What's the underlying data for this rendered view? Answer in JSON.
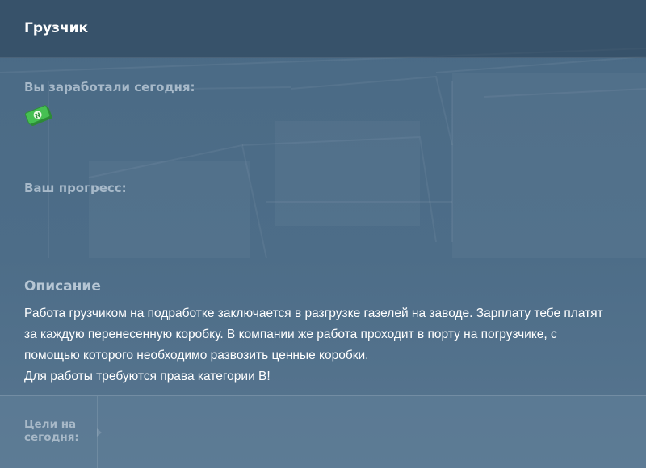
{
  "header": {
    "title": "Грузчик"
  },
  "earnings": {
    "label": "Вы заработали сегодня:",
    "icon": "money-icon"
  },
  "progress": {
    "label": "Ваш прогресс:"
  },
  "description": {
    "title": "Описание",
    "lines": [
      "Работа грузчиком на подработке заключается в разгрузке газелей на заводе. Зарплату тебе платят",
      "за каждую перенесенную коробку. В компании же работа проходит в порту на погрузчике, с",
      "помощью которого необходимо развозить ценные коробки.",
      "Для работы требуются права категории B!"
    ]
  },
  "footer": {
    "goals_label": "Цели на сегодня:"
  },
  "colors": {
    "background": "#4a6a85",
    "money_green": "#3fb34a",
    "label_muted": "#a7b9c9"
  }
}
